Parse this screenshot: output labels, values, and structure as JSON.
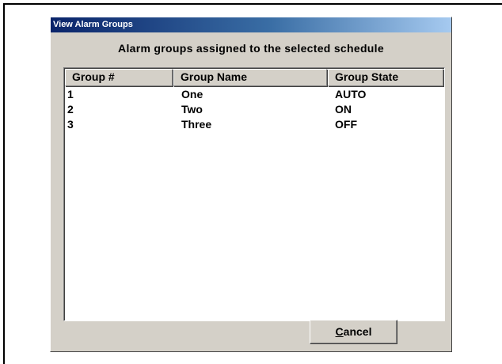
{
  "dialog": {
    "title": "View Alarm Groups",
    "caption": "Alarm groups assigned to the selected schedule"
  },
  "table": {
    "columns": [
      "Group #",
      "Group Name",
      "Group State"
    ],
    "rows": [
      {
        "number": "1",
        "name": "One",
        "state": "AUTO"
      },
      {
        "number": "2",
        "name": "Two",
        "state": "ON"
      },
      {
        "number": "3",
        "name": "Three",
        "state": "OFF"
      }
    ]
  },
  "buttons": {
    "cancel": {
      "mnemonic": "C",
      "rest": "ancel"
    }
  },
  "colors": {
    "titlebar_start": "#0a246a",
    "titlebar_end": "#a6caf0",
    "face": "#d4d0c8"
  }
}
